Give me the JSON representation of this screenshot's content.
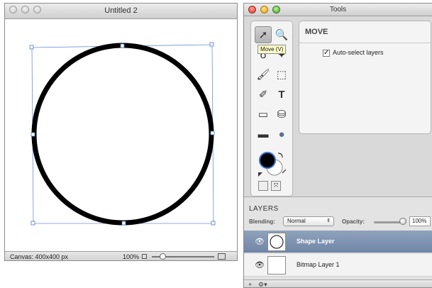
{
  "document_window": {
    "title": "Untitled 2",
    "status": {
      "canvas_size": "Canvas: 400x400 px",
      "zoom": "100%"
    }
  },
  "tools_window": {
    "title": "Tools",
    "tooltip": "Move (V)",
    "tools": [
      {
        "name": "move-tool",
        "glyph": "➚"
      },
      {
        "name": "zoom-tool",
        "glyph": "🔍"
      },
      {
        "name": "lasso-tool",
        "glyph": "ꝺ"
      },
      {
        "name": "wand-tool",
        "glyph": "✦"
      },
      {
        "name": "brush-tool",
        "glyph": "🖌"
      },
      {
        "name": "marquee-tool",
        "glyph": "⬚"
      },
      {
        "name": "eraser-tool",
        "glyph": "✐"
      },
      {
        "name": "text-tool",
        "glyph": "T"
      },
      {
        "name": "rect-shape-tool",
        "glyph": "▭"
      },
      {
        "name": "fill-tool",
        "glyph": "⛁"
      },
      {
        "name": "gradient-tool",
        "glyph": "▬"
      },
      {
        "name": "ellipse-tool",
        "glyph": "●"
      }
    ],
    "options": {
      "title": "MOVE",
      "auto_select_label": "Auto-select layers",
      "auto_select_checked": true
    },
    "layers": {
      "title": "LAYERS",
      "blending_label": "Blending:",
      "blending_value": "Normal",
      "opacity_label": "Opacity:",
      "opacity_value": "100%",
      "items": [
        {
          "name": "Shape Layer",
          "selected": true
        },
        {
          "name": "Bitmap Layer 1",
          "selected": false
        }
      ],
      "bottom_buttons": {
        "add": "+",
        "gear": "⚙▾"
      }
    }
  },
  "colors": {
    "selection_row": "#7489a8",
    "selection_outline": "#5b86d6"
  }
}
